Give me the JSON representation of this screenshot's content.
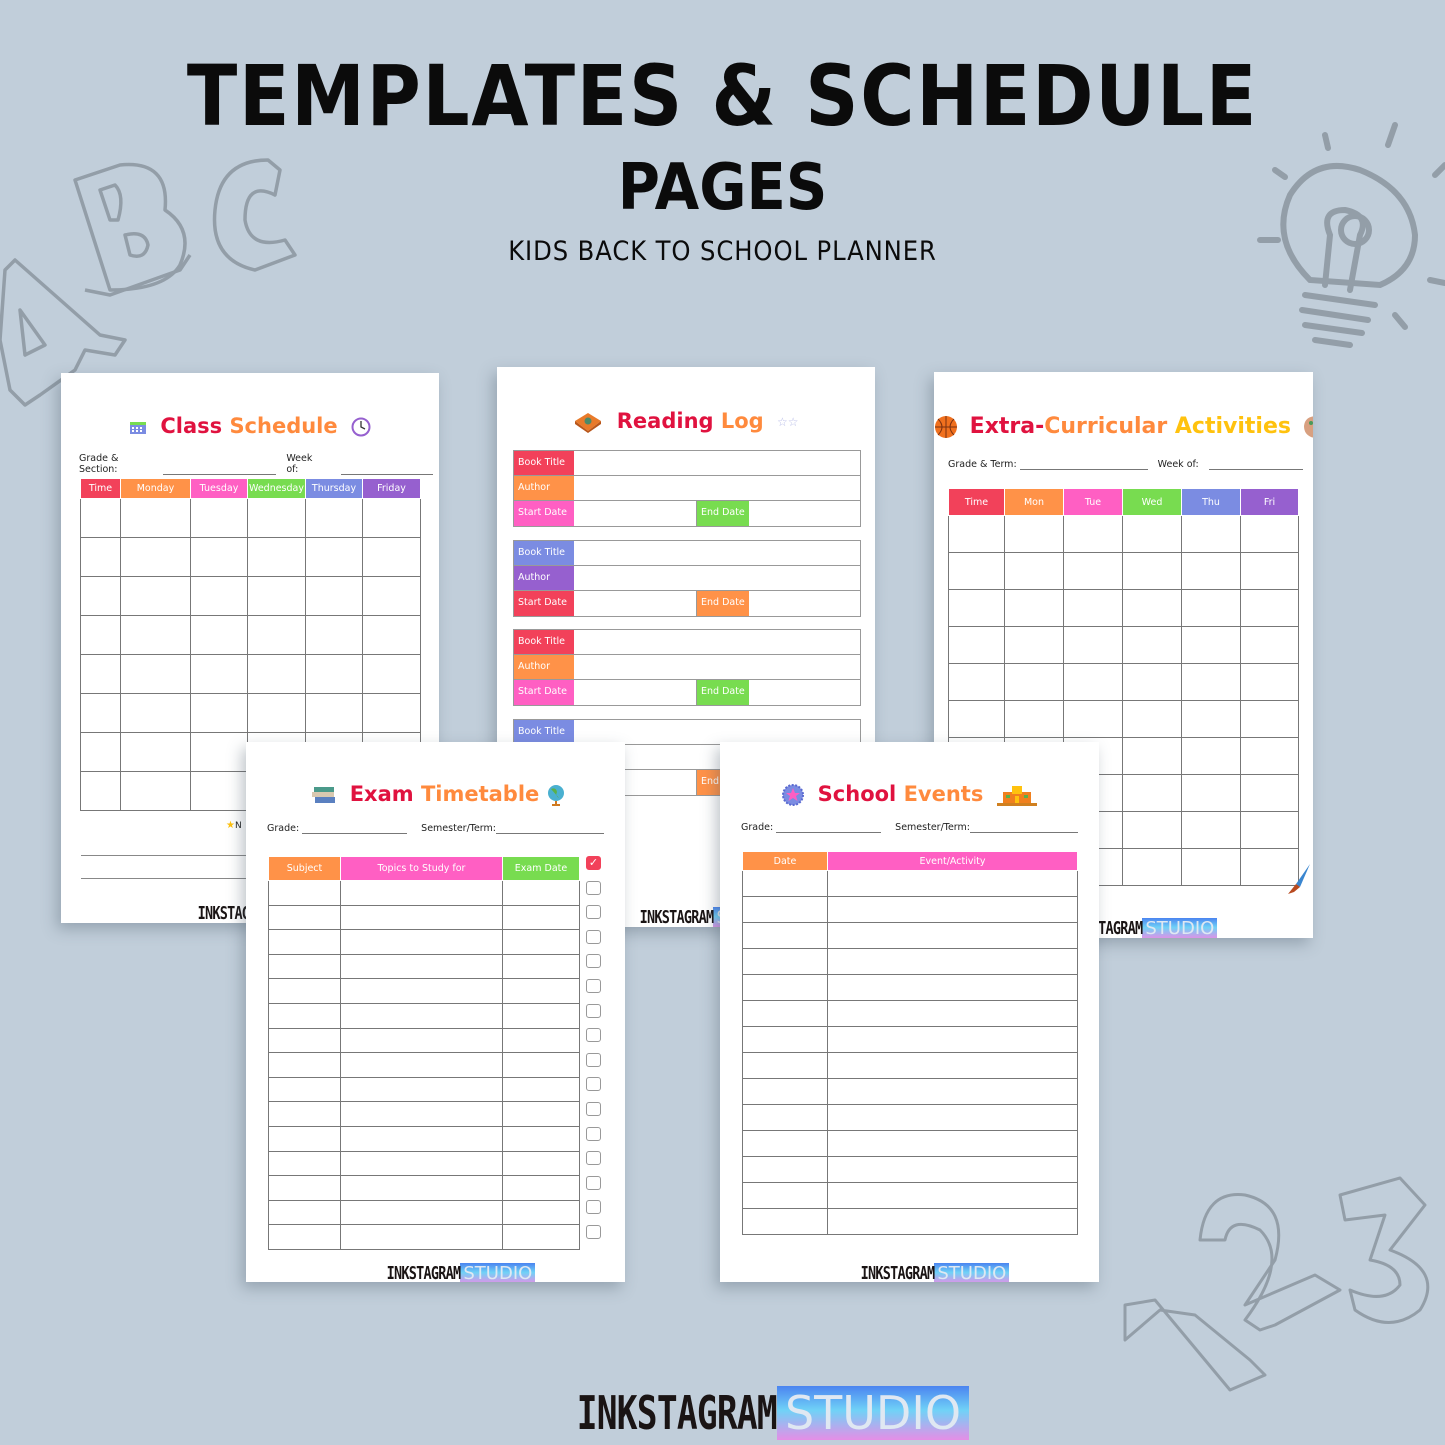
{
  "header": {
    "title_line1": "TEMPLATES & SCHEDULE",
    "title_line2": "PAGES",
    "subtitle": "KIDS BACK TO SCHOOL PLANNER"
  },
  "colors": {
    "background": "#c1ceda",
    "red": "#f2415a",
    "orange": "#ff9248",
    "pink": "#ff5fc3",
    "green": "#78dc50",
    "blue": "#7b8ce2",
    "purple": "#9660cf",
    "title_red": "#e0123f",
    "title_orange": "#ff8a3d",
    "title_yellow": "#ffc20e"
  },
  "decorations": [
    "abc-letters",
    "lightbulb",
    "numbers-123"
  ],
  "brand": {
    "ink": "INKSTAGRAM",
    "studio": "STUDIO"
  },
  "pages": {
    "class_schedule": {
      "title_a": "Class",
      "title_b": "Schedule",
      "icons": [
        "calendar-icon",
        "clock-icon"
      ],
      "field1": "Grade & Section:",
      "field2": "Week of:",
      "columns": [
        "Time",
        "Monday",
        "Tuesday",
        "Wednesday",
        "Thursday",
        "Friday"
      ],
      "notes_label": "N"
    },
    "reading_log": {
      "title_a": "Reading",
      "title_b": "Log",
      "icons": [
        "book-icon",
        "sparkles-icon"
      ],
      "labels": {
        "title": "Book Title",
        "author": "Author",
        "start": "Start Date",
        "end": "End Date"
      }
    },
    "extracurricular": {
      "title_a": "Extra-",
      "title_b": "Curricular",
      "title_c": "Activities",
      "icons": [
        "basketball-icon",
        "palette-icon",
        "paintbrush-icon"
      ],
      "field1": "Grade & Term:",
      "field2": "Week of:",
      "columns": [
        "Time",
        "Mon",
        "Tue",
        "Wed",
        "Thu",
        "Fri"
      ]
    },
    "exam_timetable": {
      "title_a": "Exam",
      "title_b": "Timetable",
      "icons": [
        "books-icon",
        "globe-icon"
      ],
      "field1": "Grade:",
      "field2": "Semester/Term:",
      "columns": [
        "Subject",
        "Topics to Study for",
        "Exam Date"
      ],
      "check_mark": "✓"
    },
    "school_events": {
      "title_a": "School",
      "title_b": "Events",
      "icons": [
        "star-badge-icon",
        "school-building-icon"
      ],
      "field1": "Grade:",
      "field2": "Semester/Term:",
      "columns": [
        "Date",
        "Event/Activity"
      ]
    }
  }
}
